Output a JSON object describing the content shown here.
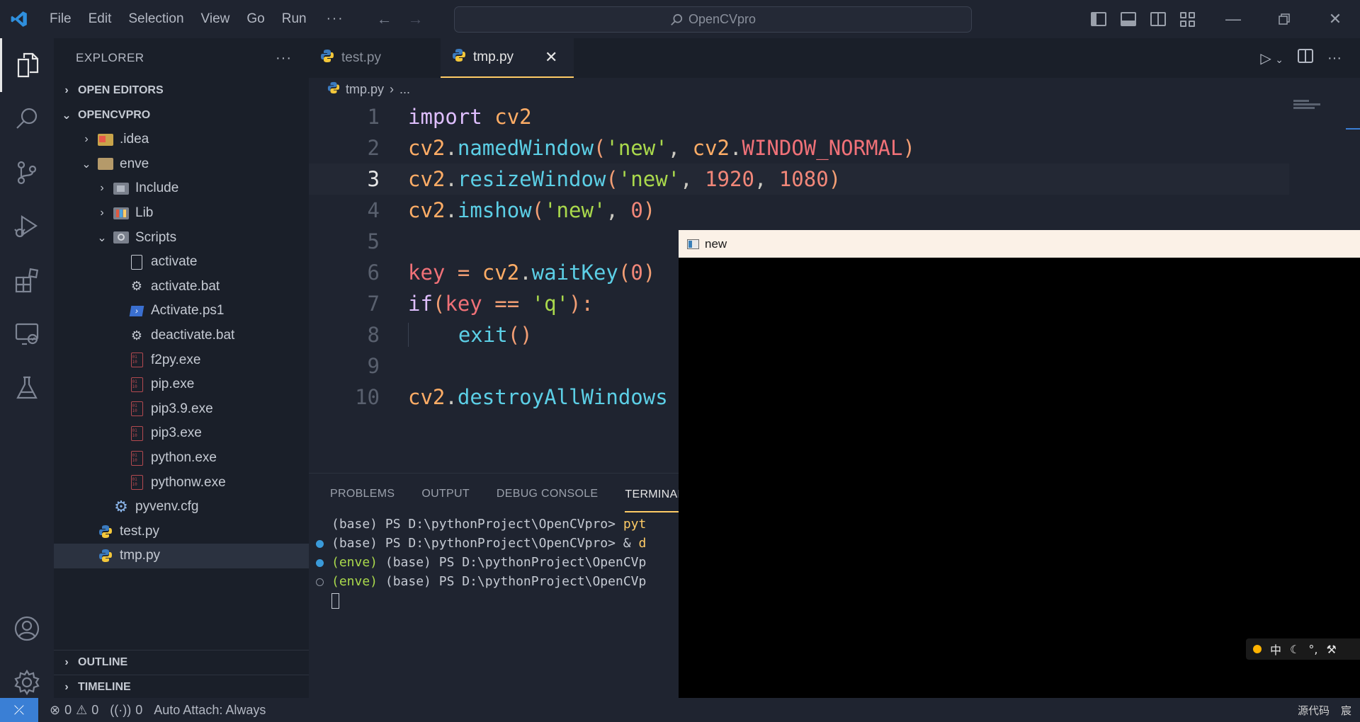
{
  "titlebar": {
    "menu": [
      "File",
      "Edit",
      "Selection",
      "View",
      "Go",
      "Run"
    ],
    "more": "···",
    "search_text": "OpenCVpro"
  },
  "sidebar": {
    "title": "EXPLORER",
    "more": "···",
    "open_editors": "OPEN EDITORS",
    "project": "OPENCVPRO",
    "tree": [
      {
        "label": ".idea",
        "depth": 1,
        "chev": "›",
        "icon": "folder-idea-icon"
      },
      {
        "label": "enve",
        "depth": 1,
        "chev": "⌄",
        "icon": "folder-open-icon"
      },
      {
        "label": "Include",
        "depth": 2,
        "chev": "›",
        "icon": "folder-include-icon"
      },
      {
        "label": "Lib",
        "depth": 2,
        "chev": "›",
        "icon": "folder-lib-icon"
      },
      {
        "label": "Scripts",
        "depth": 2,
        "chev": "⌄",
        "icon": "folder-scripts-icon"
      },
      {
        "label": "activate",
        "depth": 3,
        "icon": "file-icon"
      },
      {
        "label": "activate.bat",
        "depth": 3,
        "icon": "gears-icon"
      },
      {
        "label": "Activate.ps1",
        "depth": 3,
        "icon": "powershell-icon"
      },
      {
        "label": "deactivate.bat",
        "depth": 3,
        "icon": "gears-icon"
      },
      {
        "label": "f2py.exe",
        "depth": 3,
        "icon": "binary-icon"
      },
      {
        "label": "pip.exe",
        "depth": 3,
        "icon": "binary-icon"
      },
      {
        "label": "pip3.9.exe",
        "depth": 3,
        "icon": "binary-icon"
      },
      {
        "label": "pip3.exe",
        "depth": 3,
        "icon": "binary-icon"
      },
      {
        "label": "python.exe",
        "depth": 3,
        "icon": "binary-icon"
      },
      {
        "label": "pythonw.exe",
        "depth": 3,
        "icon": "binary-icon"
      },
      {
        "label": "pyvenv.cfg",
        "depth": 2,
        "icon": "gear-icon"
      },
      {
        "label": "test.py",
        "depth": 1,
        "icon": "python-icon"
      },
      {
        "label": "tmp.py",
        "depth": 1,
        "icon": "python-icon",
        "selected": true
      }
    ],
    "outline": "OUTLINE",
    "timeline": "TIMELINE"
  },
  "editor": {
    "tabs": [
      {
        "label": "test.py",
        "active": false
      },
      {
        "label": "tmp.py",
        "active": true
      }
    ],
    "breadcrumb": {
      "file": "tmp.py",
      "rest": "..."
    },
    "current_line": 3,
    "lines": [
      {
        "n": "1"
      },
      {
        "n": "2"
      },
      {
        "n": "3"
      },
      {
        "n": "4"
      },
      {
        "n": "5"
      },
      {
        "n": "6"
      },
      {
        "n": "7"
      },
      {
        "n": "8"
      },
      {
        "n": "9"
      },
      {
        "n": "10"
      }
    ]
  },
  "panel": {
    "tabs": [
      "PROBLEMS",
      "OUTPUT",
      "DEBUG CONSOLE",
      "TERMINAL"
    ],
    "active_tab": "TERMINAL",
    "terminal": [
      {
        "env": "",
        "text": "(base) PS D:\\pythonProject\\OpenCVpro> ",
        "tail": "pyt",
        "dot": ""
      },
      {
        "env": "",
        "text": "(base) PS D:\\pythonProject\\OpenCVpro> & ",
        "tail": "d",
        "dot": "blue"
      },
      {
        "env": "(enve)",
        "text": " (base) PS D:\\pythonProject\\OpenCVp",
        "tail": "",
        "dot": "blue"
      },
      {
        "env": "(enve)",
        "text": " (base) PS D:\\pythonProject\\OpenCVp",
        "tail": "",
        "dot": "hollow"
      }
    ]
  },
  "cv_window": {
    "title": "new"
  },
  "ime": {
    "lang": "中",
    "symbols": [
      "☾",
      "°,",
      "🔧"
    ]
  },
  "statusbar": {
    "errors": "0",
    "warnings": "0",
    "ports": "0",
    "auto_attach": "Auto Attach: Always",
    "right1": "源代码",
    "right2": "宸"
  },
  "colors": {
    "accent": "#ffcc66",
    "remote": "#3a7fd5",
    "background": "#1f2430"
  }
}
